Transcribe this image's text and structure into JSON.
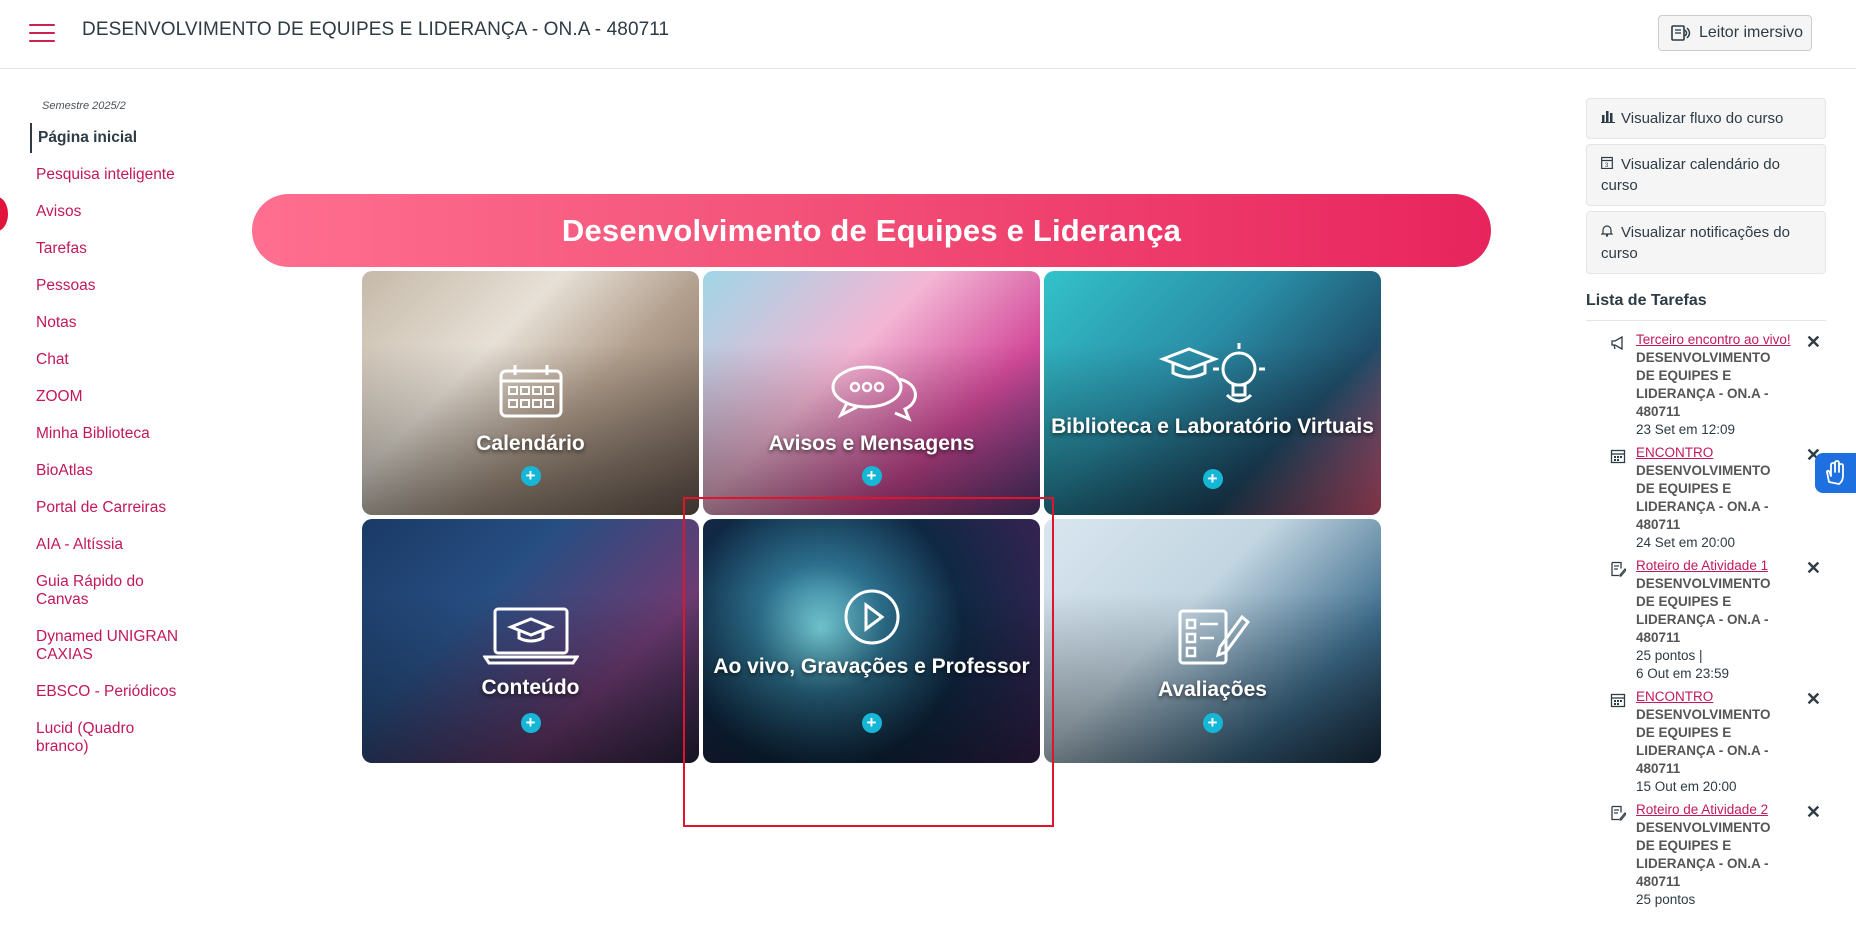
{
  "header": {
    "course_title": "DESENVOLVIMENTO DE EQUIPES E LIDERANÇA - ON.A - 480711",
    "immersive_reader": "Leitor imersivo"
  },
  "sidebar": {
    "semester": "Semestre 2025/2",
    "items": [
      {
        "label": "Página inicial"
      },
      {
        "label": "Pesquisa inteligente"
      },
      {
        "label": "Avisos"
      },
      {
        "label": "Tarefas"
      },
      {
        "label": "Pessoas"
      },
      {
        "label": "Notas"
      },
      {
        "label": "Chat"
      },
      {
        "label": "ZOOM"
      },
      {
        "label": "Minha Biblioteca"
      },
      {
        "label": "BioAtlas"
      },
      {
        "label": "Portal de Carreiras"
      },
      {
        "label": "AIA - Altíssia"
      },
      {
        "label": "Guia Rápido do Canvas"
      },
      {
        "label": "Dynamed UNIGRAN CAXIAS"
      },
      {
        "label": "EBSCO - Periódicos"
      },
      {
        "label": "Lucid (Quadro branco)"
      }
    ]
  },
  "main": {
    "banner_title": "Desenvolvimento de Equipes e Liderança",
    "tiles": [
      {
        "label": "Calendário",
        "icon": "calendar-icon"
      },
      {
        "label": "Avisos e Mensagens",
        "icon": "chat-bubbles-icon"
      },
      {
        "label": "Biblioteca e Laboratório Virtuais",
        "icon": "lightbulb-graduation-icon"
      },
      {
        "label": "Conteúdo",
        "icon": "laptop-graduation-icon"
      },
      {
        "label": "Ao vivo, Gravações e Professor",
        "icon": "play-icon"
      },
      {
        "label": "Avaliações",
        "icon": "checklist-icon"
      }
    ],
    "plus": "+"
  },
  "right": {
    "buttons": {
      "course_flow": "Visualizar fluxo do curso",
      "course_calendar": "Visualizar calendário do curso",
      "course_notifications": "Visualizar notificações do curso"
    },
    "todo_title": "Lista de Tarefas",
    "todos": [
      {
        "title": "Terceiro encontro ao vivo!",
        "course": "DESENVOLVIMENTO DE EQUIPES E LIDERANÇA - ON.A - 480711",
        "meta": "23 Set em 12:09",
        "icon": "megaphone-icon"
      },
      {
        "title": "ENCONTRO",
        "course": "DESENVOLVIMENTO DE EQUIPES E LIDERANÇA - ON.A - 480711",
        "meta": "24 Set em 20:00",
        "icon": "calendar-icon"
      },
      {
        "title": "Roteiro de Atividade 1",
        "course": "DESENVOLVIMENTO DE EQUIPES E LIDERANÇA - ON.A - 480711",
        "meta": "25 pontos  |",
        "meta2": "6 Out em 23:59",
        "icon": "assignment-icon"
      },
      {
        "title": "ENCONTRO",
        "course": "DESENVOLVIMENTO DE EQUIPES E LIDERANÇA - ON.A - 480711",
        "meta": "15 Out em 20:00",
        "icon": "calendar-icon"
      },
      {
        "title": "Roteiro de Atividade 2",
        "course": "DESENVOLVIMENTO DE EQUIPES E LIDERANÇA - ON.A - 480711",
        "meta": "25 pontos",
        "icon": "assignment-icon"
      }
    ],
    "close_glyph": "✕"
  },
  "colors": {
    "accent": "#c2185b",
    "banner_start": "#ff6f8f",
    "banner_end": "#e8245d",
    "plus_button": "#15b6d6",
    "highlight": "#e0142d"
  }
}
